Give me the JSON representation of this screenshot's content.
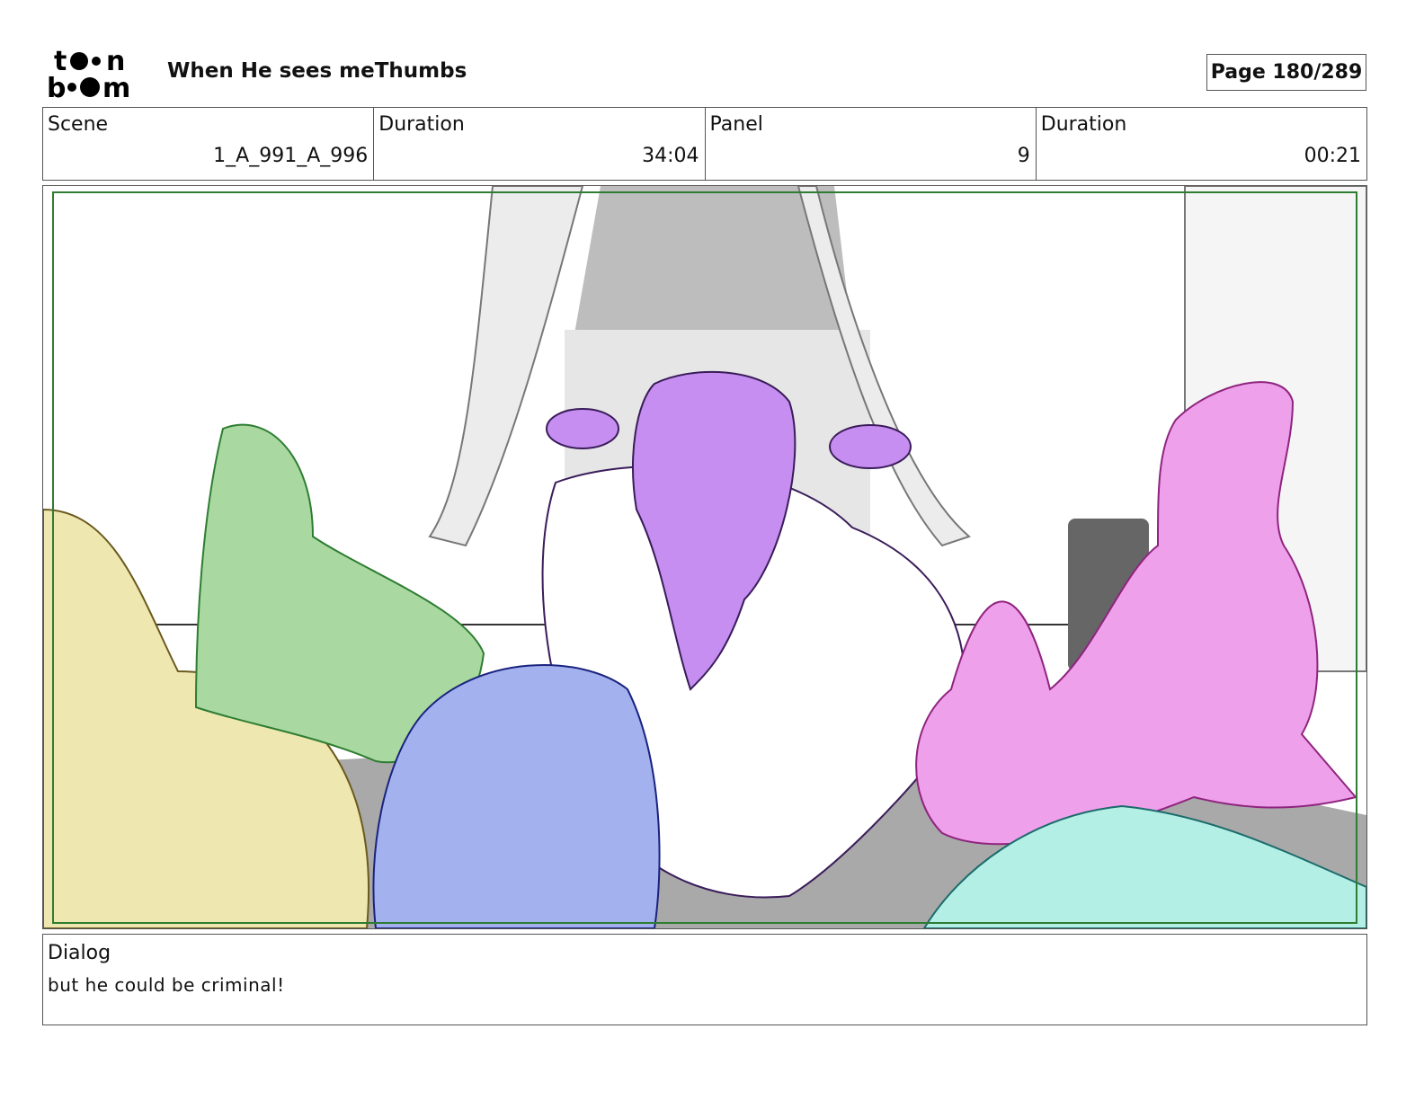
{
  "header": {
    "logo_text": "toon boom",
    "title": "When He sees meThumbs",
    "page_label": "Page 180/289"
  },
  "info": {
    "scene_label": "Scene",
    "scene_value": "1_A_991_A_996",
    "scene_duration_label": "Duration",
    "scene_duration_value": "34:04",
    "panel_label": "Panel",
    "panel_value": "9",
    "panel_duration_label": "Duration",
    "panel_duration_value": "00:21"
  },
  "dialog": {
    "label": "Dialog",
    "text": "but he could be criminal!"
  },
  "colors": {
    "frame_green": "#2e7d32",
    "yellow": "#efe7b0",
    "green": "#a9d9a0",
    "blue": "#a3b2ef",
    "purple": "#c58ef0",
    "pink": "#efa0ea",
    "teal": "#b3efe5",
    "floor": "#a9a9a9"
  }
}
